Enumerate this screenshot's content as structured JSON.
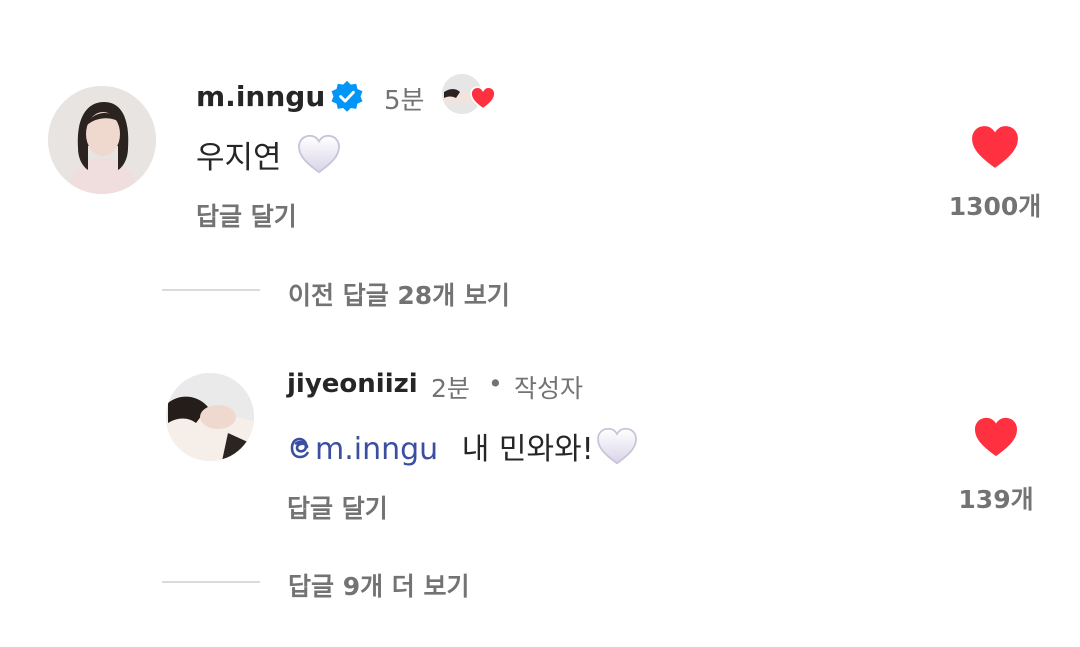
{
  "comments": [
    {
      "username": "m.inngu",
      "verified": true,
      "time": "5분",
      "text": "우지연",
      "text_emoji": "white-heart",
      "reply_label": "답글 달기",
      "likes": "1300개",
      "liked_by_creator": true
    }
  ],
  "threads": {
    "prev_replies": "이전 답글 28개 보기",
    "more_replies": "답글 9개 더 보기"
  },
  "reply": {
    "username": "jiyeoniizi",
    "time": "2분",
    "separator": "•",
    "author_badge": "작성자",
    "mention": "m.inngu",
    "text": "내 민와와!",
    "text_emoji": "white-heart",
    "reply_label": "답글 달기",
    "likes": "139개"
  },
  "colors": {
    "like_red": "#ff3040",
    "verified_blue": "#0095f6",
    "mention_blue": "#3b4fa0",
    "secondary_text": "#737373"
  }
}
